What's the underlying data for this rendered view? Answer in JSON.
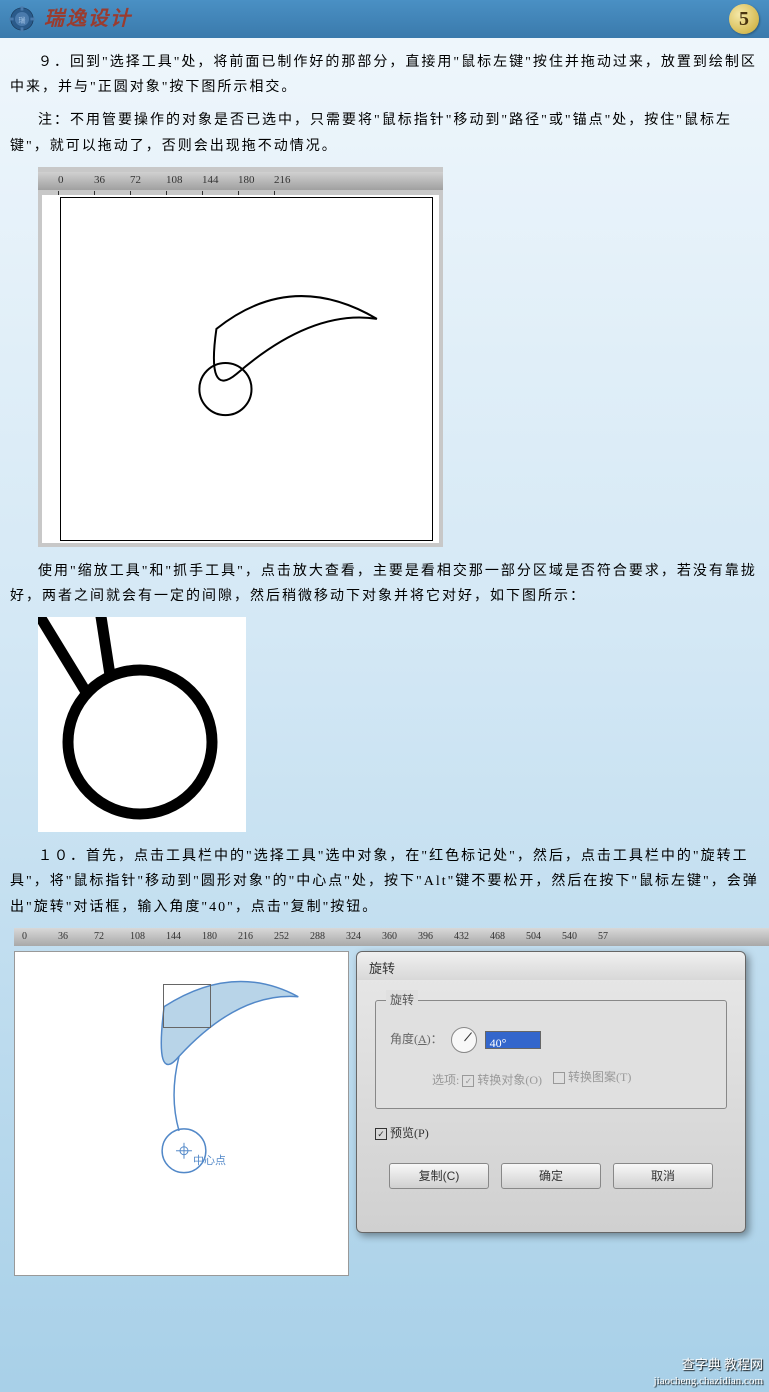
{
  "header": {
    "title": "瑞逸设计",
    "page_number": "5"
  },
  "paragraphs": {
    "p1": "９．回到\"选择工具\"处，将前面已制作好的那部分，直接用\"鼠标左键\"按住并拖动过来，放置到绘制区中来，并与\"正圆对象\"按下图所示相交。",
    "p2": "注：不用管要操作的对象是否已选中，只需要将\"鼠标指针\"移动到\"路径\"或\"锚点\"处，按住\"鼠标左键\"，就可以拖动了，否则会出现拖不动情况。",
    "p3": "使用\"缩放工具\"和\"抓手工具\"，点击放大查看，主要是看相交那一部分区域是否符合要求，若没有靠拢好，两者之间就会有一定的间隙，然后稍微移动下对象并将它对好，如下图所示：",
    "p4": "１０．首先，点击工具栏中的\"选择工具\"选中对象，在\"红色标记处\"，然后，点击工具栏中的\"旋转工具\"，将\"鼠标指针\"移动到\"圆形对象\"的\"中心点\"处，按下\"Alt\"键不要松开，然后在按下\"鼠标左键\"，会弹出\"旋转\"对话框，输入角度\"40\"，点击\"复制\"按钮。"
  },
  "ruler1": [
    "0",
    "36",
    "72",
    "108",
    "144",
    "180",
    "216"
  ],
  "ruler3": [
    "0",
    "36",
    "72",
    "108",
    "144",
    "180",
    "216",
    "252",
    "288",
    "324",
    "360",
    "396",
    "432",
    "468",
    "504",
    "540",
    "57"
  ],
  "figure3": {
    "center_label": "中心点"
  },
  "dialog": {
    "title": "旋转",
    "fieldset_legend": "旋转",
    "angle_label_pre": "角度(",
    "angle_label_u": "A",
    "angle_label_post": ")：",
    "angle_value": "40°",
    "option_label": "选项:",
    "opt1_pre": "转换对象(",
    "opt1_u": "O",
    "opt1_post": ")",
    "opt2_pre": "转换图案(",
    "opt2_u": "T",
    "opt2_post": ")",
    "preview_pre": "预览(",
    "preview_u": "P",
    "preview_post": ")",
    "btn_copy_pre": "复制(",
    "btn_copy_u": "C",
    "btn_copy_post": ")",
    "btn_ok": "确定",
    "btn_cancel": "取消"
  },
  "watermark": {
    "main": "查字典 教程网",
    "sub": "jiaocheng.chazidian.com"
  }
}
